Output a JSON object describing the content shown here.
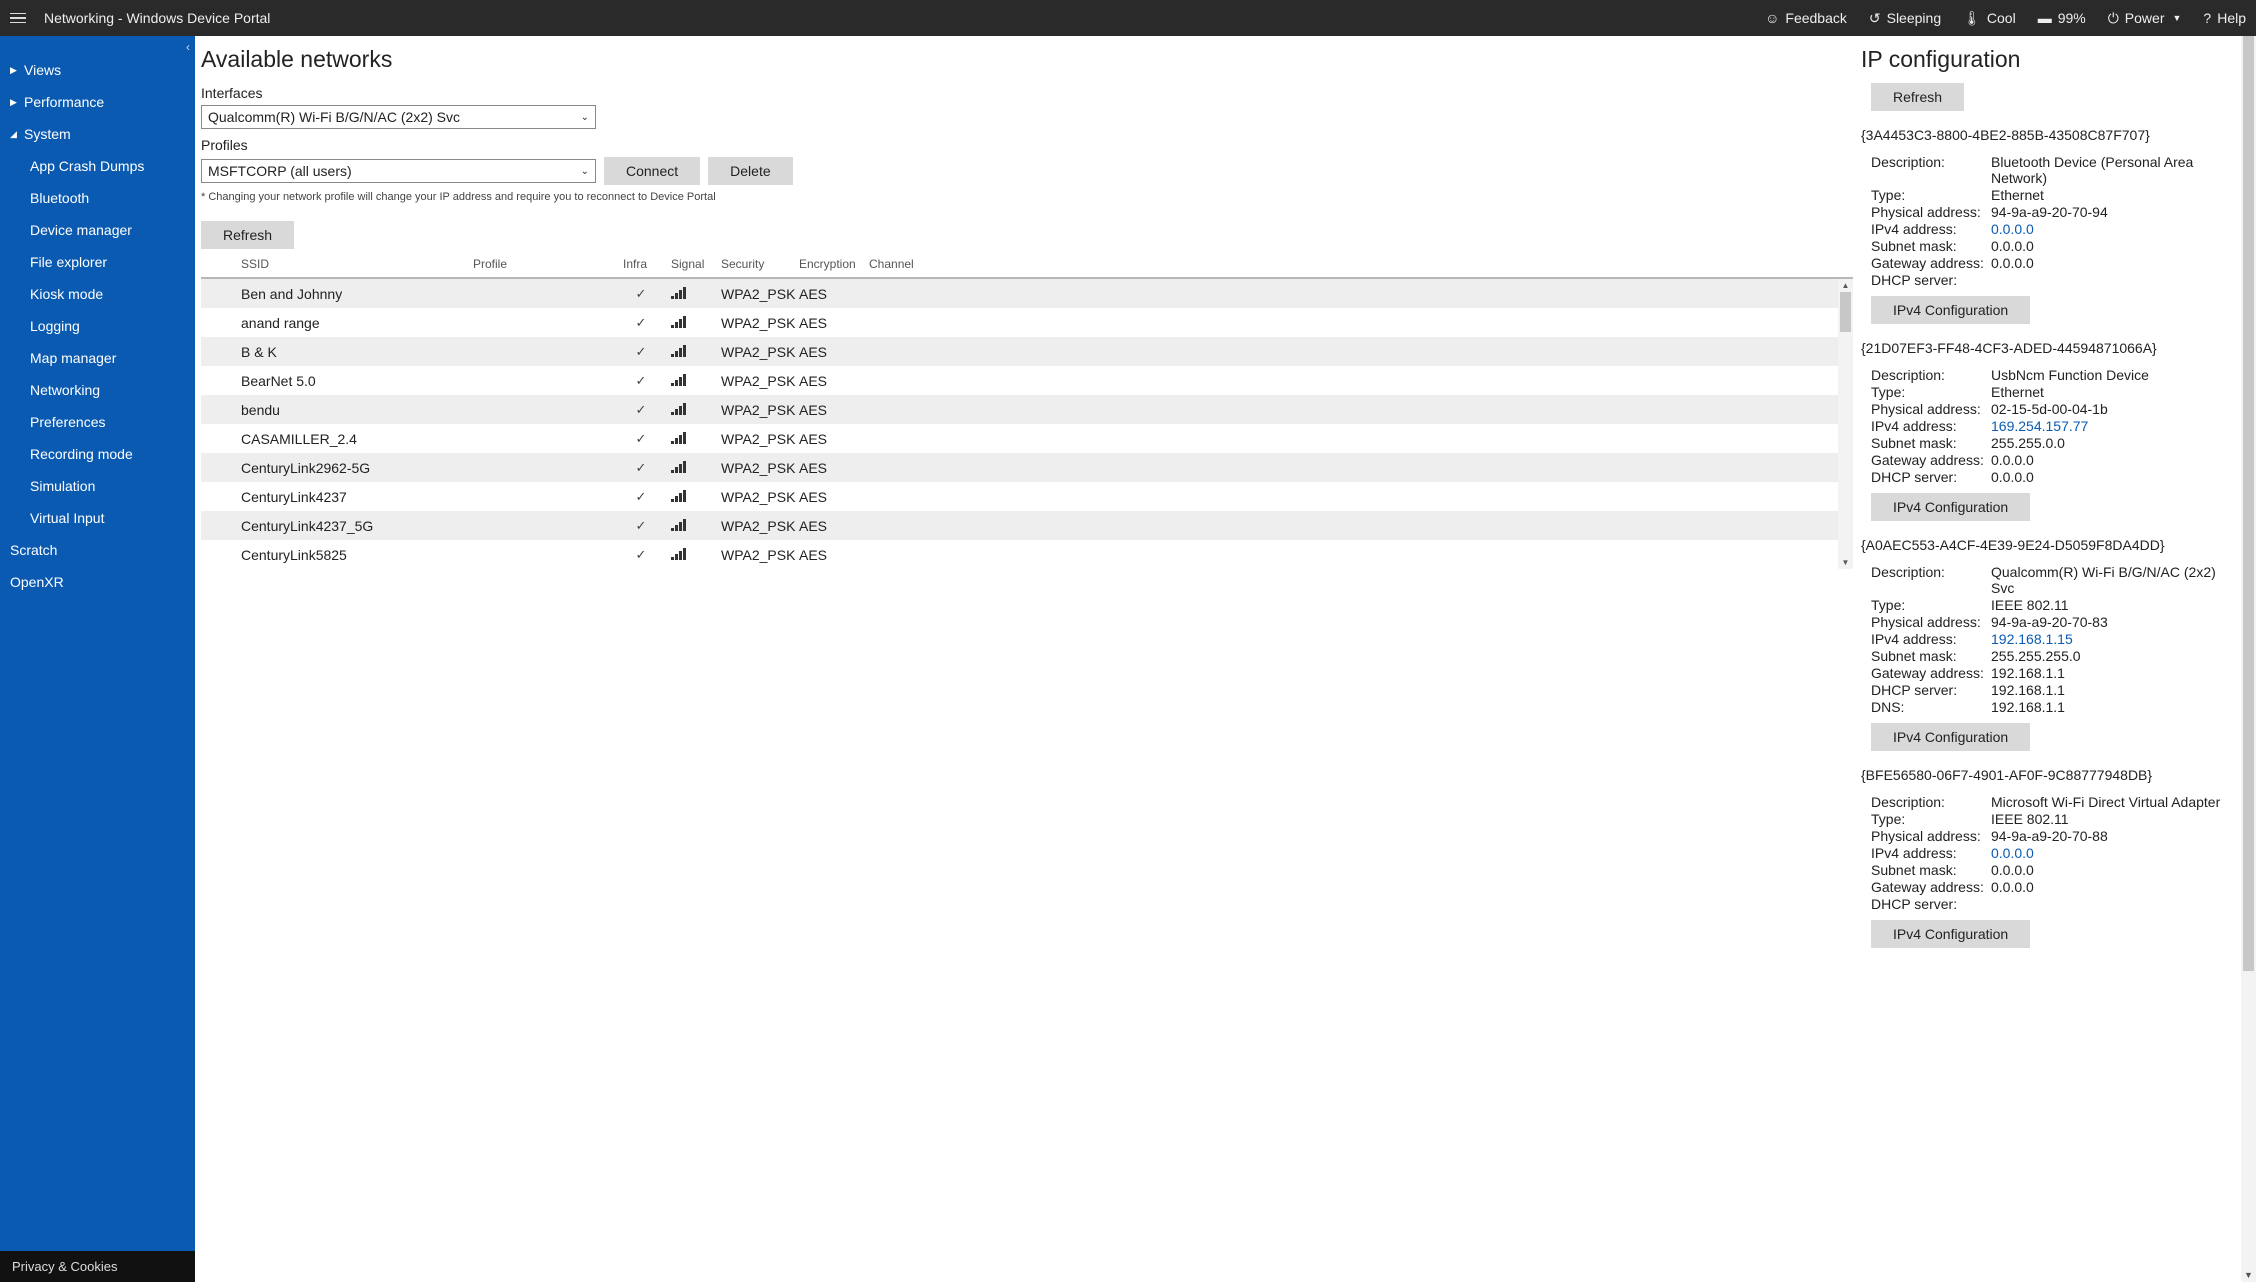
{
  "header": {
    "title": "Networking - Windows Device Portal",
    "feedback": "Feedback",
    "sleeping": "Sleeping",
    "cool": "Cool",
    "battery": "99%",
    "power": "Power",
    "help": "Help"
  },
  "sidebar": {
    "items": [
      {
        "label": "Views",
        "expanded": false,
        "level": 0
      },
      {
        "label": "Performance",
        "expanded": false,
        "level": 0
      },
      {
        "label": "System",
        "expanded": true,
        "level": 0
      },
      {
        "label": "App Crash Dumps",
        "level": 1
      },
      {
        "label": "Bluetooth",
        "level": 1
      },
      {
        "label": "Device manager",
        "level": 1
      },
      {
        "label": "File explorer",
        "level": 1
      },
      {
        "label": "Kiosk mode",
        "level": 1
      },
      {
        "label": "Logging",
        "level": 1
      },
      {
        "label": "Map manager",
        "level": 1
      },
      {
        "label": "Networking",
        "level": 1
      },
      {
        "label": "Preferences",
        "level": 1
      },
      {
        "label": "Recording mode",
        "level": 1
      },
      {
        "label": "Simulation",
        "level": 1
      },
      {
        "label": "Virtual Input",
        "level": 1
      },
      {
        "label": "Scratch",
        "level": 0,
        "leaf": true
      },
      {
        "label": "OpenXR",
        "level": 0,
        "leaf": true
      }
    ],
    "footer": "Privacy & Cookies"
  },
  "networks": {
    "title": "Available networks",
    "interfaces_label": "Interfaces",
    "interface_selected": "Qualcomm(R) Wi-Fi B/G/N/AC (2x2) Svc",
    "profiles_label": "Profiles",
    "profile_selected": "MSFTCORP (all users)",
    "connect": "Connect",
    "delete": "Delete",
    "hint": "* Changing your network profile will change your IP address and require you to reconnect to Device Portal",
    "refresh": "Refresh",
    "columns": {
      "ssid": "SSID",
      "profile": "Profile",
      "infra": "Infra",
      "signal": "Signal",
      "security": "Security",
      "encryption": "Encryption",
      "channel": "Channel"
    },
    "rows": [
      {
        "ssid": "Ben and Johnny",
        "infra": true,
        "security": "WPA2_PSK",
        "encryption": "AES"
      },
      {
        "ssid": "anand range",
        "infra": true,
        "security": "WPA2_PSK",
        "encryption": "AES"
      },
      {
        "ssid": "B & K",
        "infra": true,
        "security": "WPA2_PSK",
        "encryption": "AES"
      },
      {
        "ssid": "BearNet 5.0",
        "infra": true,
        "security": "WPA2_PSK",
        "encryption": "AES"
      },
      {
        "ssid": "bendu",
        "infra": true,
        "security": "WPA2_PSK",
        "encryption": "AES"
      },
      {
        "ssid": "CASAMILLER_2.4",
        "infra": true,
        "security": "WPA2_PSK",
        "encryption": "AES"
      },
      {
        "ssid": "CenturyLink2962-5G",
        "infra": true,
        "security": "WPA2_PSK",
        "encryption": "AES"
      },
      {
        "ssid": "CenturyLink4237",
        "infra": true,
        "security": "WPA2_PSK",
        "encryption": "AES"
      },
      {
        "ssid": "CenturyLink4237_5G",
        "infra": true,
        "security": "WPA2_PSK",
        "encryption": "AES"
      },
      {
        "ssid": "CenturyLink5825",
        "infra": true,
        "security": "WPA2_PSK",
        "encryption": "AES"
      }
    ]
  },
  "ipconfig": {
    "title": "IP configuration",
    "refresh": "Refresh",
    "button": "IPv4 Configuration",
    "labels": {
      "description": "Description:",
      "type": "Type:",
      "physical": "Physical address:",
      "ipv4": "IPv4 address:",
      "subnet": "Subnet mask:",
      "gateway": "Gateway address:",
      "dhcp": "DHCP server:",
      "dns": "DNS:"
    },
    "adapters": [
      {
        "guid": "{3A4453C3-8800-4BE2-885B-43508C87F707}",
        "description": "Bluetooth Device (Personal Area Network)",
        "type": "Ethernet",
        "physical": "94-9a-a9-20-70-94",
        "ipv4": "0.0.0.0",
        "subnet": "0.0.0.0",
        "gateway": "0.0.0.0",
        "dhcp": ""
      },
      {
        "guid": "{21D07EF3-FF48-4CF3-ADED-44594871066A}",
        "description": "UsbNcm Function Device",
        "type": "Ethernet",
        "physical": "02-15-5d-00-04-1b",
        "ipv4": "169.254.157.77",
        "subnet": "255.255.0.0",
        "gateway": "0.0.0.0",
        "dhcp": "0.0.0.0"
      },
      {
        "guid": "{A0AEC553-A4CF-4E39-9E24-D5059F8DA4DD}",
        "description": "Qualcomm(R) Wi-Fi B/G/N/AC (2x2) Svc",
        "type": "IEEE 802.11",
        "physical": "94-9a-a9-20-70-83",
        "ipv4": "192.168.1.15",
        "subnet": "255.255.255.0",
        "gateway": "192.168.1.1",
        "dhcp": "192.168.1.1",
        "dns": "192.168.1.1"
      },
      {
        "guid": "{BFE56580-06F7-4901-AF0F-9C88777948DB}",
        "description": "Microsoft Wi-Fi Direct Virtual Adapter",
        "type": "IEEE 802.11",
        "physical": "94-9a-a9-20-70-88",
        "ipv4": "0.0.0.0",
        "subnet": "0.0.0.0",
        "gateway": "0.0.0.0",
        "dhcp": ""
      }
    ]
  }
}
